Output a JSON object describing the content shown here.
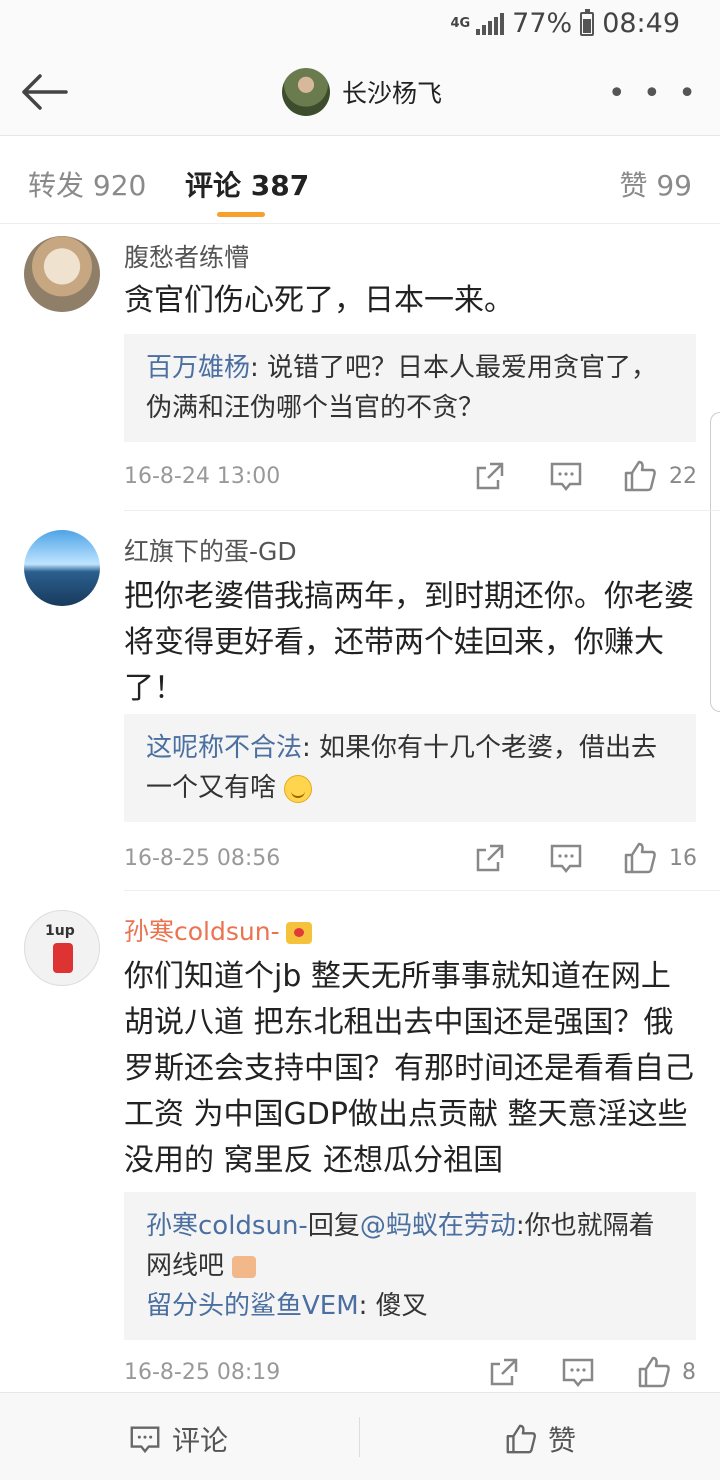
{
  "status": {
    "network": "4G",
    "battery": "77%",
    "time": "08:49"
  },
  "header": {
    "title": "长沙杨飞",
    "more": "• • •"
  },
  "tabs": {
    "repost": "转发 920",
    "comments": "评论 387",
    "likes": "赞 99"
  },
  "comments": [
    {
      "name": "腹愁者练懵",
      "text": "贪官们伤心死了，日本一来。",
      "replies": [
        {
          "name": "百万雄杨",
          "text": ": 说错了吧？日本人最爱用贪官了，伪满和汪伪哪个当官的不贪？"
        }
      ],
      "time": "16-8-24 13:00",
      "likes": "22"
    },
    {
      "name": "红旗下的蛋-GD",
      "text": "把你老婆借我搞两年，到时期还你。你老婆将变得更好看，还带两个娃回来，你赚大了！",
      "replies": [
        {
          "name": "这呢称不合法",
          "text": ": 如果你有十几个老婆，借出去一个又有啥"
        }
      ],
      "time": "16-8-25 08:56",
      "likes": "16"
    },
    {
      "name": "孙寒coldsun-",
      "text": "你们知道个jb 整天无所事事就知道在网上胡说八道 把东北租出去中国还是强国？俄罗斯还会支持中国？有那时间还是看看自己工资 为中国GDP做出点贡献 整天意淫这些没用的 窝里反 还想瓜分祖国",
      "replies": [
        {
          "name": "孙寒coldsun-",
          "mid": "回复",
          "at": "@蚂蚁在劳动",
          "text": ":你也就隔着网线吧"
        },
        {
          "name": "留分头的鲨鱼VEM",
          "text": ": 傻叉"
        }
      ],
      "time": "16-8-25 08:19",
      "likes": "8"
    }
  ],
  "bottom": {
    "comment": "评论",
    "like": "赞"
  }
}
